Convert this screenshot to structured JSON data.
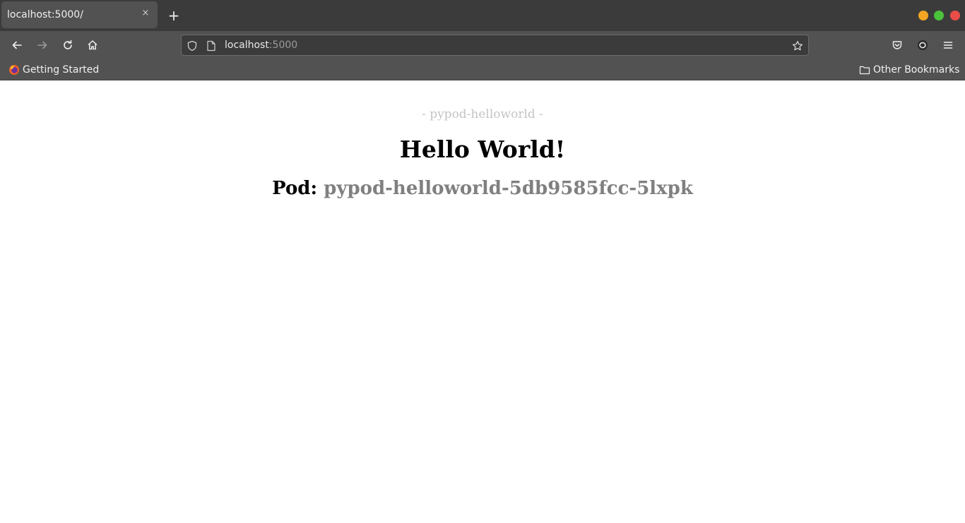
{
  "browser": {
    "tab": {
      "title": "localhost:5000/",
      "close_glyph": "×"
    },
    "new_tab_glyph": "+",
    "window_controls": {
      "minimize_color": "#f4a623",
      "maximize_color": "#4cc13b",
      "close_color": "#ea4d48"
    },
    "url": {
      "host": "localhost",
      "port": ":5000"
    },
    "bookmarks": {
      "getting_started": "Getting Started",
      "other_bookmarks": "Other Bookmarks"
    },
    "icons": [
      "back-icon",
      "forward-icon",
      "reload-icon",
      "home-icon",
      "shield-icon",
      "page-icon",
      "star-icon",
      "pocket-icon",
      "extension-icon",
      "menu-icon",
      "firefox-icon",
      "folder-icon"
    ]
  },
  "page": {
    "subtitle": "- pypod-helloworld -",
    "headline": "Hello World!",
    "pod_label": "Pod:",
    "pod_name": "pypod-helloworld-5db9585fcc-5lxpk"
  },
  "colors": {
    "chrome_dark": "#3b3b3b",
    "chrome": "#525252",
    "pod_name": "#808080",
    "subtitle": "#c4c4c4"
  }
}
